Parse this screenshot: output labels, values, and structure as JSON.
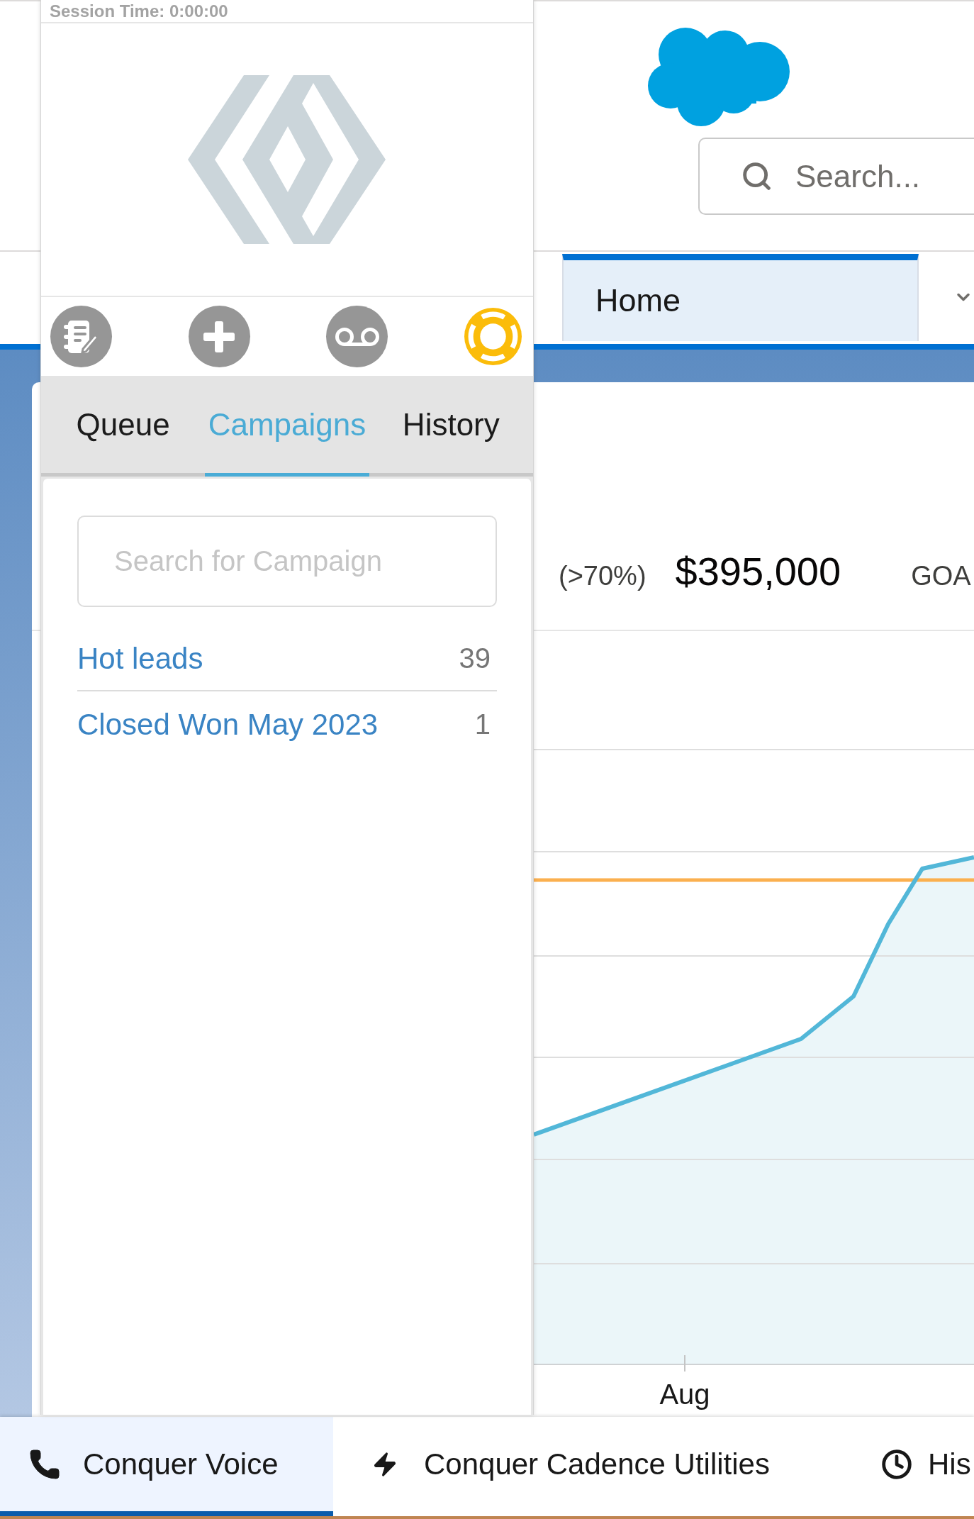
{
  "softphone": {
    "session_time": "Session Time: 0:00:00",
    "tabs": [
      {
        "label": "Queue",
        "selected": false
      },
      {
        "label": "Campaigns",
        "selected": true
      },
      {
        "label": "History",
        "selected": false
      }
    ],
    "search": {
      "placeholder": "Search for Campaign"
    },
    "campaigns": [
      {
        "name": "Hot leads",
        "count": "39"
      },
      {
        "name": "Closed Won May 2023",
        "count": "1"
      }
    ]
  },
  "header": {
    "search": {
      "placeholder": "Search..."
    }
  },
  "nav": {
    "tabs": [
      {
        "label": "Home",
        "selected": true
      }
    ]
  },
  "dashboard": {
    "summary": [
      {
        "kind": "label",
        "text": "(>70%)"
      },
      {
        "kind": "value",
        "text": "$395,000"
      },
      {
        "kind": "label",
        "text": "GOA"
      }
    ],
    "chart": {
      "x_labels": [
        "Aug"
      ]
    }
  },
  "utility_bar": {
    "items": [
      {
        "label": "Conquer Voice",
        "selected": true
      },
      {
        "label": "Conquer Cadence Utilities",
        "selected": false
      },
      {
        "label": "His",
        "selected": false
      }
    ]
  }
}
